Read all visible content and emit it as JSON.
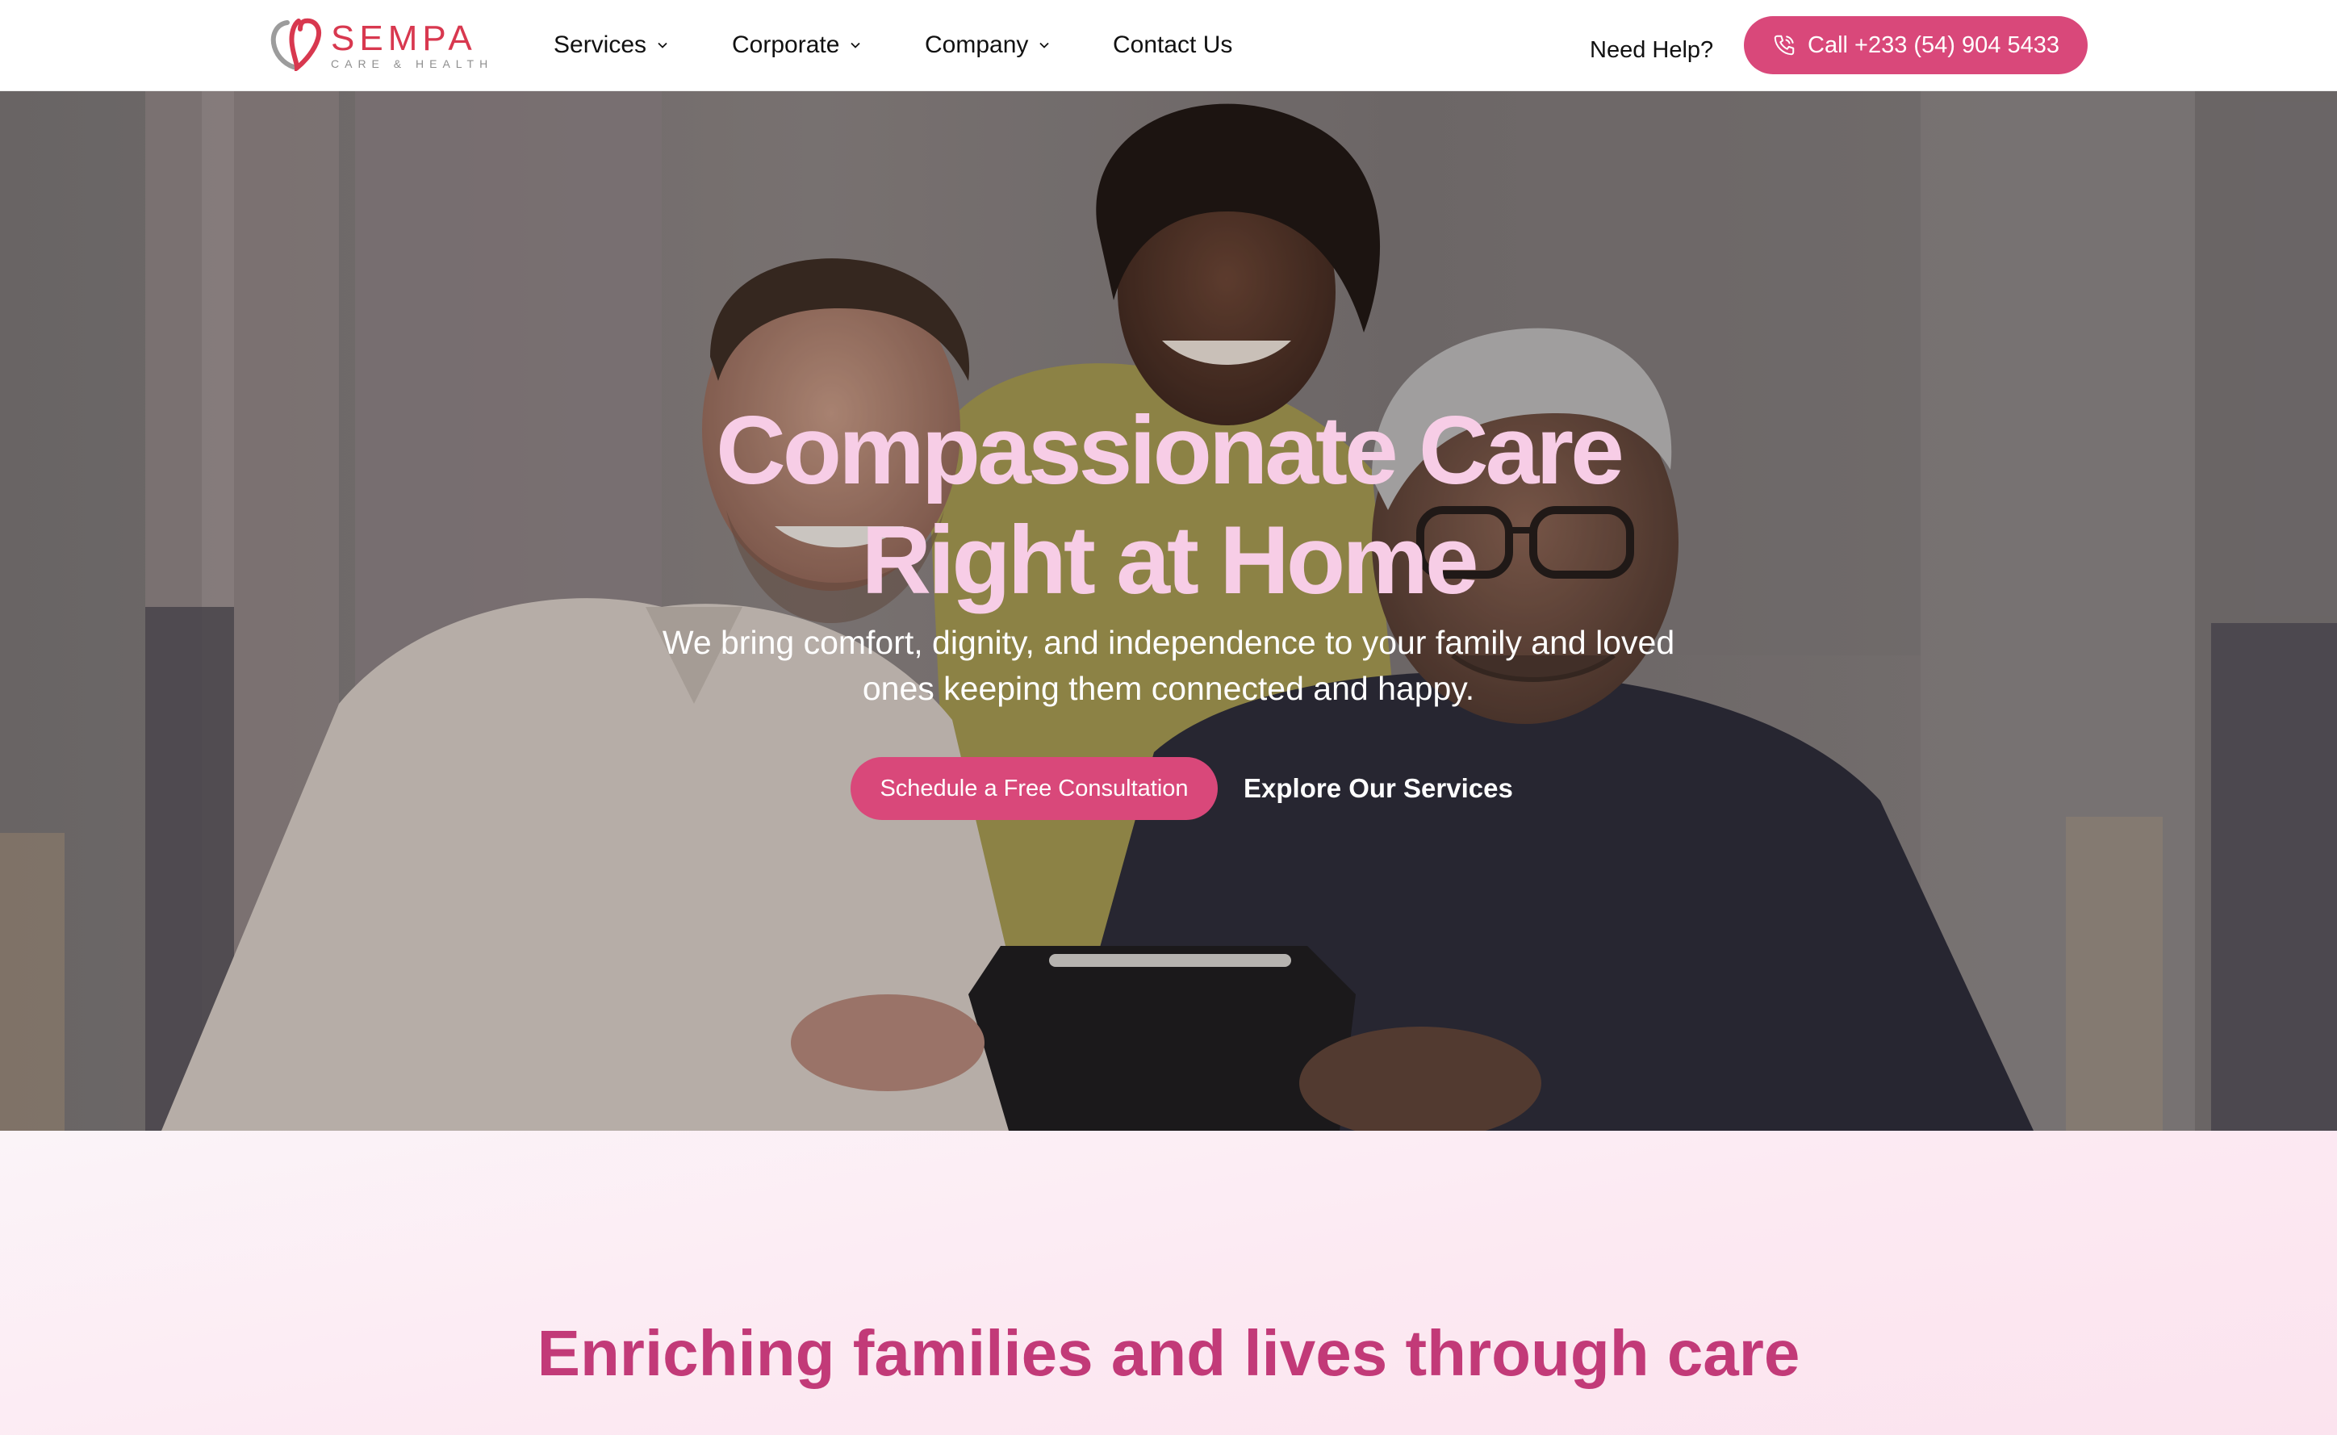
{
  "brand": {
    "name": "SEMPA",
    "tagline": "CARE & HEALTH",
    "logo_icon": "heart-outline-icon",
    "primary_color": "#d9487a",
    "logo_color": "#d8384f",
    "heading_color": "#c23a78",
    "hero_title_color": "#f7cde6"
  },
  "nav": {
    "items": [
      {
        "label": "Services",
        "has_dropdown": true,
        "icon": "chevron-down-icon"
      },
      {
        "label": "Corporate",
        "has_dropdown": true,
        "icon": "chevron-down-icon"
      },
      {
        "label": "Company",
        "has_dropdown": true,
        "icon": "chevron-down-icon"
      },
      {
        "label": "Contact Us",
        "has_dropdown": false
      }
    ],
    "help_text": "Need Help?",
    "call_label": "Call +233 (54) 904 5433",
    "call_icon": "phone-icon"
  },
  "hero": {
    "title_line1": "Compassionate Care",
    "title_line2": "Right at Home",
    "subtitle": "We bring comfort, dignity, and independence to your family and loved ones keeping them connected and happy.",
    "cta_primary": "Schedule a Free Consultation",
    "cta_secondary": "Explore Our Services",
    "image": "family-caregiver-photo"
  },
  "section": {
    "title": "Enriching families and lives through care"
  }
}
